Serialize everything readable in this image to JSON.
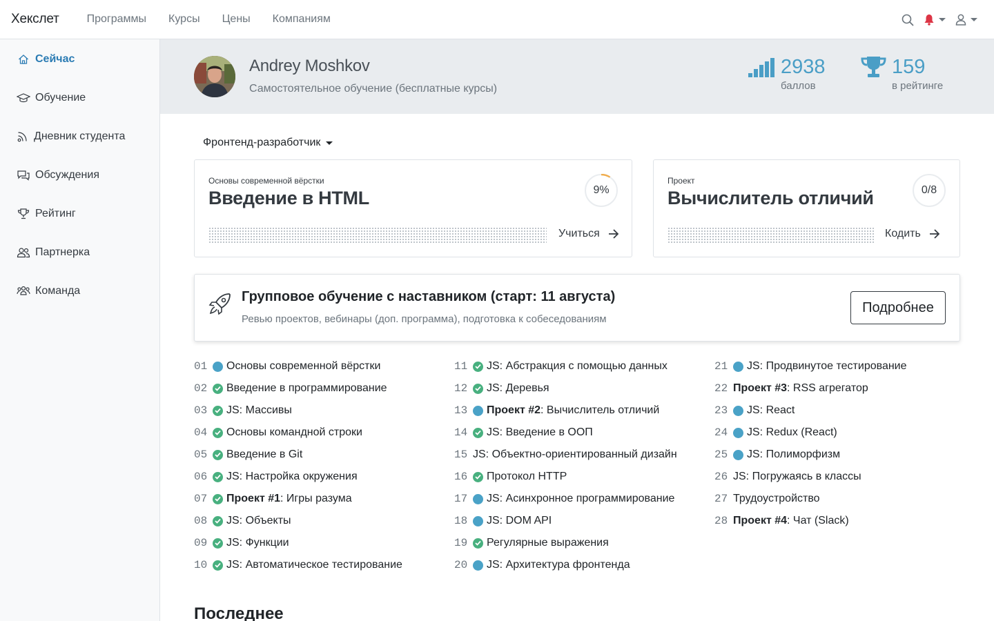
{
  "navbar": {
    "brand": "Хекслет",
    "links": [
      "Программы",
      "Курсы",
      "Цены",
      "Компаниям"
    ]
  },
  "sidebar": {
    "items": [
      {
        "label": "Сейчас",
        "icon": "home-icon",
        "active": true
      },
      {
        "label": "Обучение",
        "icon": "graduation-cap-icon"
      },
      {
        "label": "Дневник студента",
        "icon": "journal-icon"
      },
      {
        "label": "Обсуждения",
        "icon": "comments-icon"
      },
      {
        "label": "Рейтинг",
        "icon": "trophy-icon"
      },
      {
        "label": "Партнерка",
        "icon": "users-icon"
      },
      {
        "label": "Команда",
        "icon": "team-icon"
      }
    ]
  },
  "profile": {
    "name": "Andrey Moshkov",
    "subtitle": "Самостоятельное обучение (бесплатные курсы)",
    "points": {
      "value": "2938",
      "label": "баллов"
    },
    "rank": {
      "value": "159",
      "label": "в рейтинге"
    }
  },
  "track": {
    "selected": "Фронтенд-разработчик"
  },
  "cards": {
    "course": {
      "caption": "Основы современной вёрстки",
      "title": "Введение в HTML",
      "progress": "9%",
      "action": "Учиться"
    },
    "project": {
      "caption": "Проект",
      "title": "Вычислитель отличий",
      "progress": "0/8",
      "action": "Кодить"
    }
  },
  "banner": {
    "title": "Групповое обучение с наставником (старт: 11 августа)",
    "subtitle": "Ревью проектов, вебинары (доп. программа), подготовка к собеседованиям",
    "button": "Подробнее"
  },
  "courses": [
    {
      "num": "01",
      "status": "progress",
      "bold": "",
      "text": "Основы современной вёрстки"
    },
    {
      "num": "02",
      "status": "done",
      "bold": "",
      "text": "Введение в программирование"
    },
    {
      "num": "03",
      "status": "done",
      "bold": "",
      "text": "JS: Массивы"
    },
    {
      "num": "04",
      "status": "done",
      "bold": "",
      "text": "Основы командной строки"
    },
    {
      "num": "05",
      "status": "done",
      "bold": "",
      "text": "Введение в Git"
    },
    {
      "num": "06",
      "status": "done",
      "bold": "",
      "text": "JS: Настройка окружения"
    },
    {
      "num": "07",
      "status": "done",
      "bold": "Проект #1",
      "text": ": Игры разума"
    },
    {
      "num": "08",
      "status": "done",
      "bold": "",
      "text": "JS: Объекты"
    },
    {
      "num": "09",
      "status": "done",
      "bold": "",
      "text": "JS: Функции"
    },
    {
      "num": "10",
      "status": "done",
      "bold": "",
      "text": "JS: Автоматическое тестирование"
    },
    {
      "num": "11",
      "status": "done",
      "bold": "",
      "text": "JS: Абстракция с помощью данных"
    },
    {
      "num": "12",
      "status": "done",
      "bold": "",
      "text": "JS: Деревья"
    },
    {
      "num": "13",
      "status": "progress",
      "bold": "Проект #2",
      "text": ": Вычислитель отличий"
    },
    {
      "num": "14",
      "status": "done",
      "bold": "",
      "text": "JS: Введение в ООП"
    },
    {
      "num": "15",
      "status": "none",
      "bold": "",
      "text": "JS: Объектно-ориентированный дизайн"
    },
    {
      "num": "16",
      "status": "done",
      "bold": "",
      "text": "Протокол HTTP"
    },
    {
      "num": "17",
      "status": "progress",
      "bold": "",
      "text": "JS: Асинхронное программирование"
    },
    {
      "num": "18",
      "status": "progress",
      "bold": "",
      "text": "JS: DOM API"
    },
    {
      "num": "19",
      "status": "done",
      "bold": "",
      "text": "Регулярные выражения"
    },
    {
      "num": "20",
      "status": "progress",
      "bold": "",
      "text": "JS: Архитектура фронтенда"
    },
    {
      "num": "21",
      "status": "progress",
      "bold": "",
      "text": "JS: Продвинутое тестирование"
    },
    {
      "num": "22",
      "status": "none",
      "bold": "Проект #3",
      "text": ": RSS агрегатор"
    },
    {
      "num": "23",
      "status": "progress",
      "bold": "",
      "text": "JS: React"
    },
    {
      "num": "24",
      "status": "progress",
      "bold": "",
      "text": "JS: Redux (React)"
    },
    {
      "num": "25",
      "status": "progress",
      "bold": "",
      "text": "JS: Полиморфизм"
    },
    {
      "num": "26",
      "status": "none",
      "bold": "",
      "text": "JS: Погружаясь в классы"
    },
    {
      "num": "27",
      "status": "none",
      "bold": "",
      "text": "Трудоустройство"
    },
    {
      "num": "28",
      "status": "none",
      "bold": "Проект #4",
      "text": ": Чат (Slack)"
    }
  ],
  "recent": {
    "heading": "Последнее"
  },
  "colors": {
    "accent": "#4a9ec6",
    "done": "#48b07f",
    "progress": "#4aa2c7",
    "notification": "#dc3545",
    "progress_ring": "#f0ad4e"
  }
}
